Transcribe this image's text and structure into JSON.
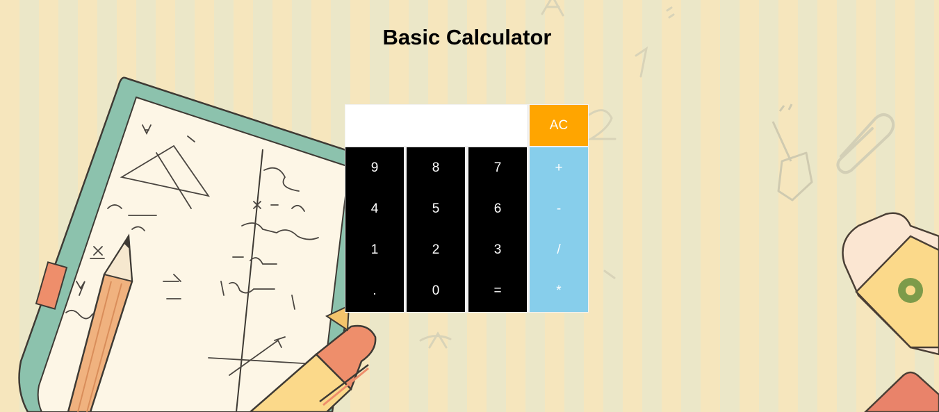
{
  "page": {
    "title": "Basic Calculator"
  },
  "calculator": {
    "display_value": "",
    "buttons": {
      "ac": "AC",
      "n9": "9",
      "n8": "8",
      "n7": "7",
      "plus": "+",
      "n4": "4",
      "n5": "5",
      "n6": "6",
      "minus": "-",
      "n1": "1",
      "n2": "2",
      "n3": "3",
      "divide": "/",
      "dot": ".",
      "n0": "0",
      "equals": "=",
      "multiply": "*"
    },
    "colors": {
      "number_bg": "#000000",
      "operator_bg": "#87ceeb",
      "clear_bg": "#ffa500",
      "display_bg": "#ffffff"
    }
  },
  "background": {
    "illustration_icons": [
      "notebook-icon",
      "pencil-icon",
      "pen-icon",
      "pushpin-icon",
      "paperclip-icon",
      "eraser-icon"
    ]
  }
}
